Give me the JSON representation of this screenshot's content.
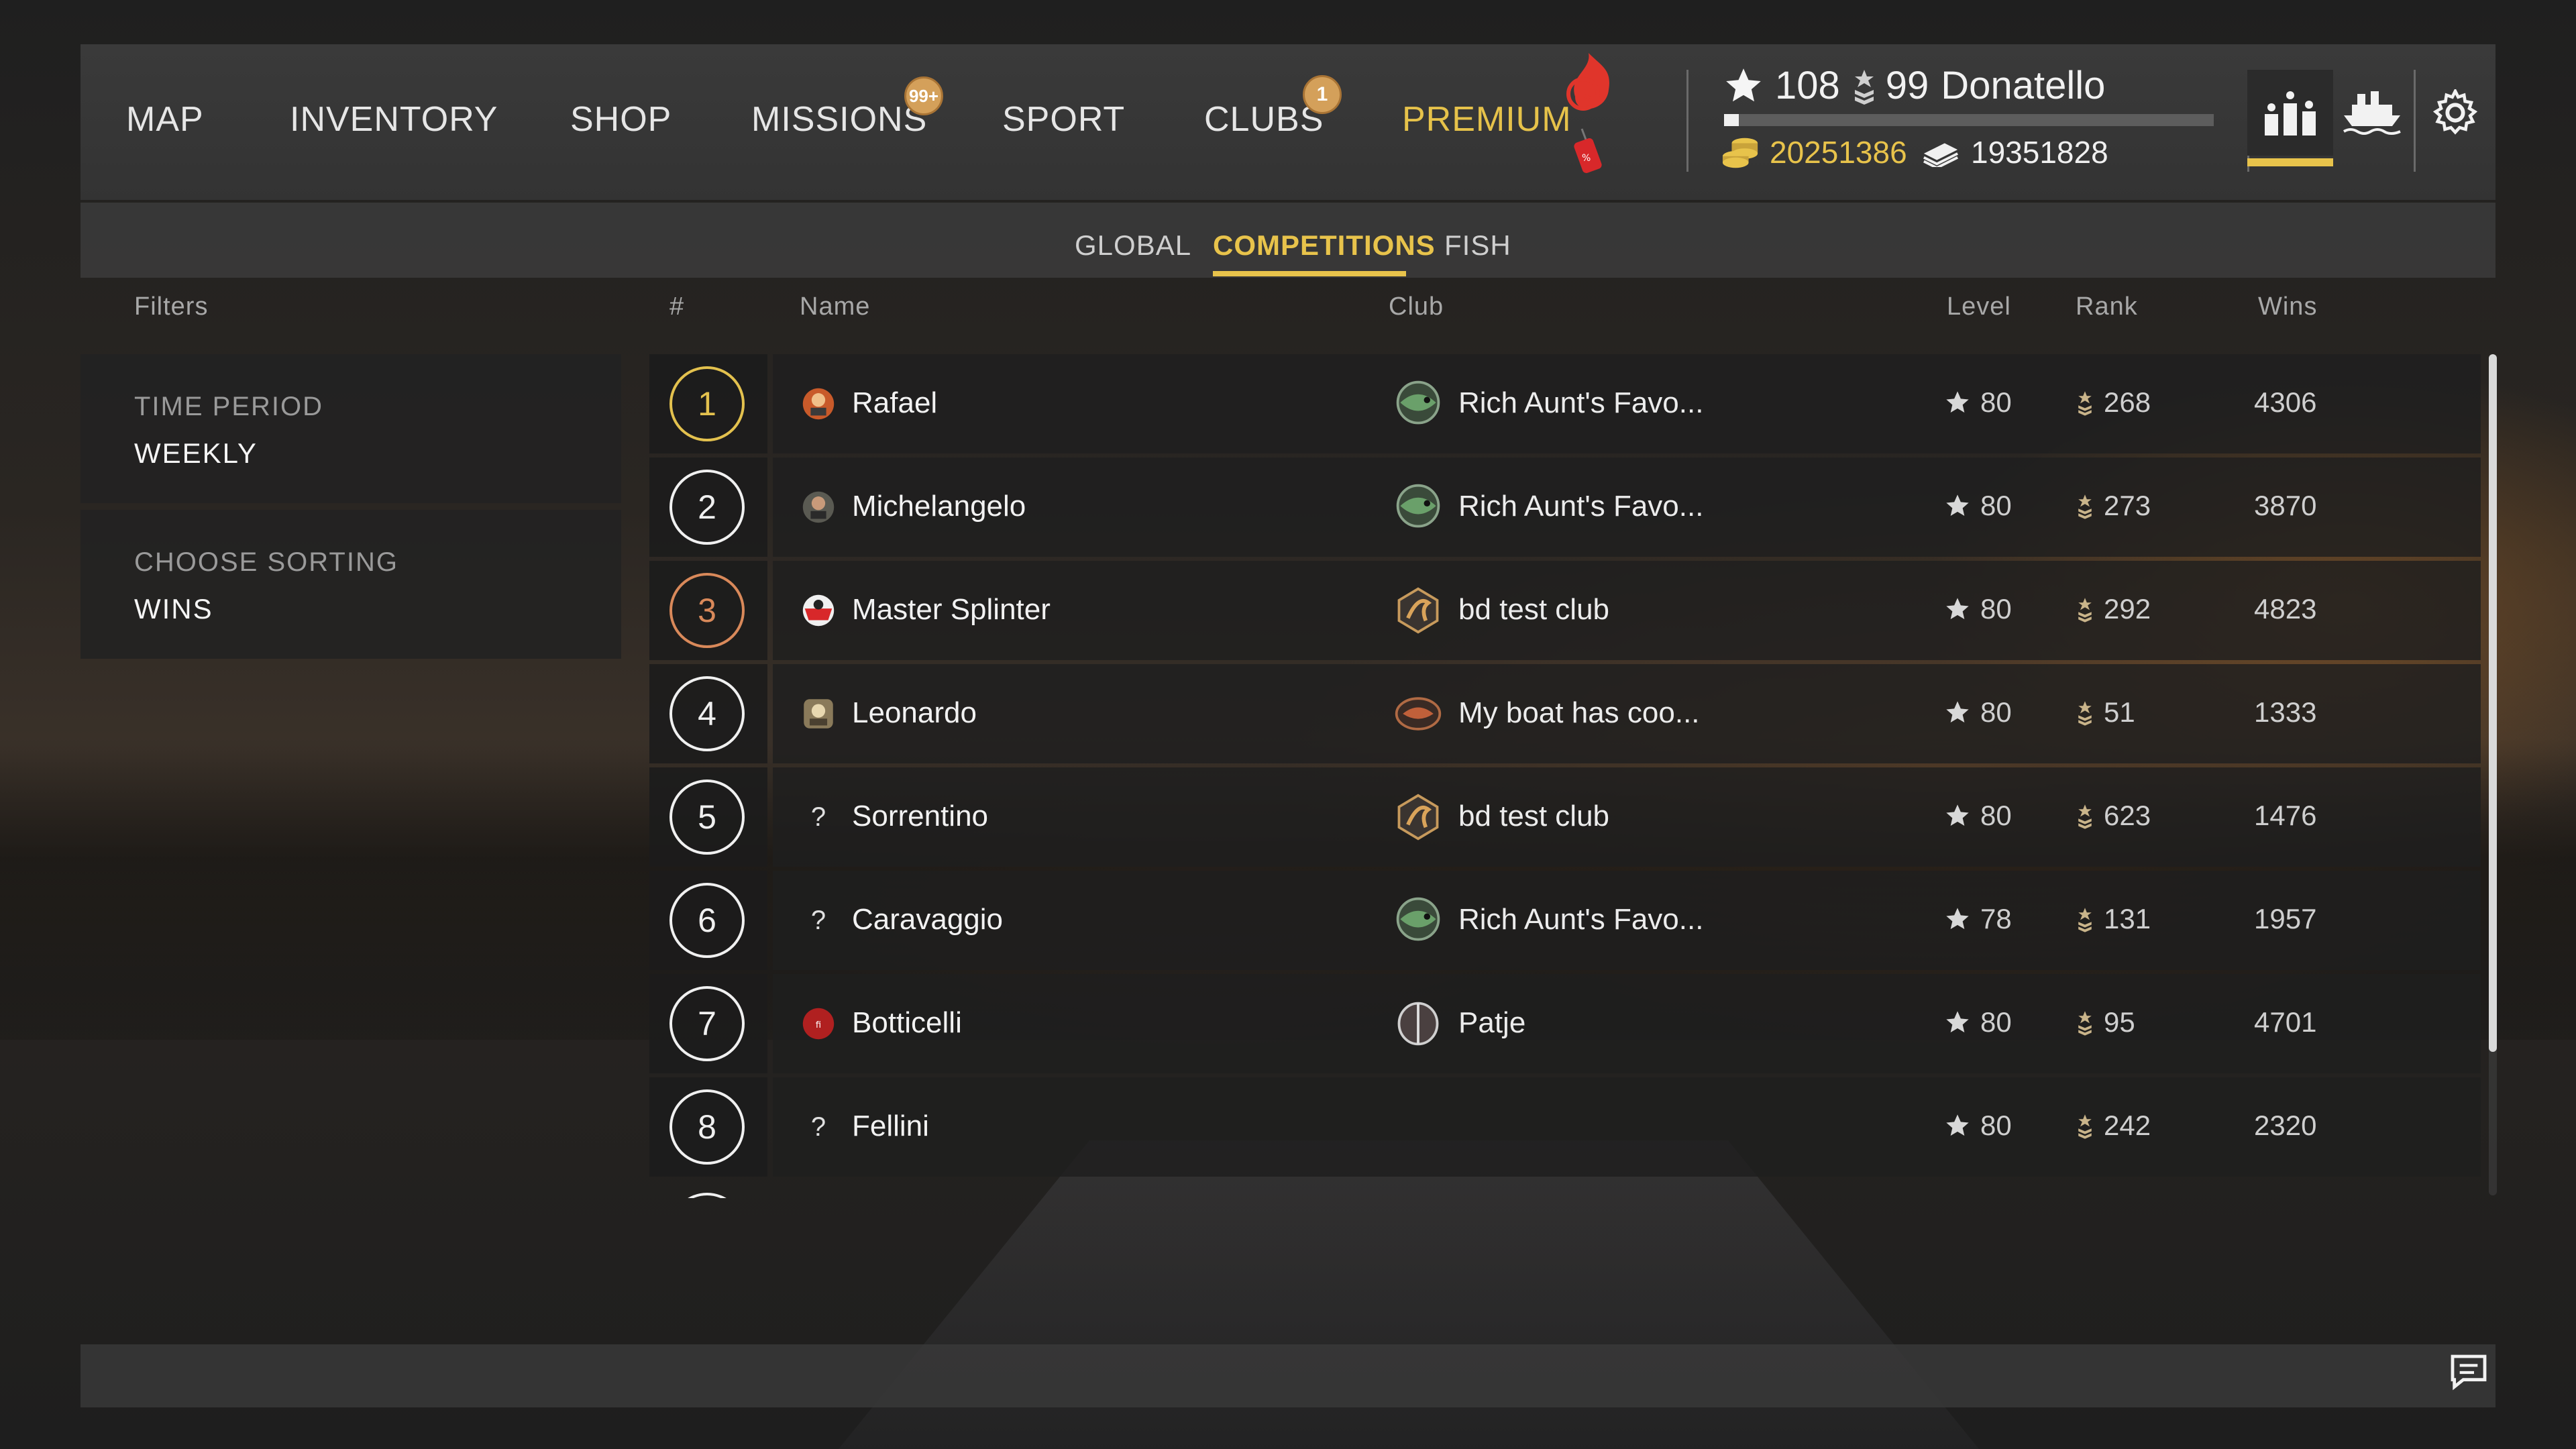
{
  "nav": {
    "items": [
      {
        "label": "MAP"
      },
      {
        "label": "INVENTORY"
      },
      {
        "label": "SHOP"
      },
      {
        "label": "MISSIONS",
        "badge": "99+"
      },
      {
        "label": "SPORT"
      },
      {
        "label": "CLUBS",
        "badge": "1"
      },
      {
        "label": "PREMIUM"
      }
    ]
  },
  "player": {
    "level": "108",
    "rank": "99",
    "name": "Donatello",
    "xp_progress": 0.03,
    "gold": "20251386",
    "silver": "19351828"
  },
  "tabs": [
    {
      "label": "GLOBAL"
    },
    {
      "label": "COMPETITIONS",
      "active": true
    },
    {
      "label": "FISH"
    }
  ],
  "columns": {
    "filters": "Filters",
    "number": "#",
    "name": "Name",
    "club": "Club",
    "level": "Level",
    "rank": "Rank",
    "wins": "Wins"
  },
  "filters": {
    "time_period": {
      "label": "TIME PERIOD",
      "value": "WEEKLY"
    },
    "sorting": {
      "label": "CHOOSE SORTING",
      "value": "WINS"
    }
  },
  "rows": [
    {
      "pos": "1",
      "name": "Rafael",
      "club": "Rich Aunt's Favo...",
      "level": "80",
      "rank": "268",
      "wins": "4306"
    },
    {
      "pos": "2",
      "name": "Michelangelo",
      "club": "Rich Aunt's Favo...",
      "level": "80",
      "rank": "273",
      "wins": "3870"
    },
    {
      "pos": "3",
      "name": "Master Splinter",
      "club": "bd test club",
      "level": "80",
      "rank": "292",
      "wins": "4823"
    },
    {
      "pos": "4",
      "name": "Leonardo",
      "club": "My boat has coo...",
      "level": "80",
      "rank": "51",
      "wins": "1333"
    },
    {
      "pos": "5",
      "name": "Sorrentino",
      "club": "bd test club",
      "level": "80",
      "rank": "623",
      "wins": "1476"
    },
    {
      "pos": "6",
      "name": "Caravaggio",
      "club": "Rich Aunt's Favo...",
      "level": "78",
      "rank": "131",
      "wins": "1957"
    },
    {
      "pos": "7",
      "name": "Botticelli",
      "club": "Patje",
      "level": "80",
      "rank": "95",
      "wins": "4701"
    },
    {
      "pos": "8",
      "name": "Fellini",
      "club": "",
      "level": "80",
      "rank": "242",
      "wins": "2320"
    }
  ],
  "unknown_avatar": "?",
  "colors": {
    "accent": "#e8c34b",
    "gold_rank": "#e3c14e",
    "bronze_rank": "#d9895a"
  }
}
